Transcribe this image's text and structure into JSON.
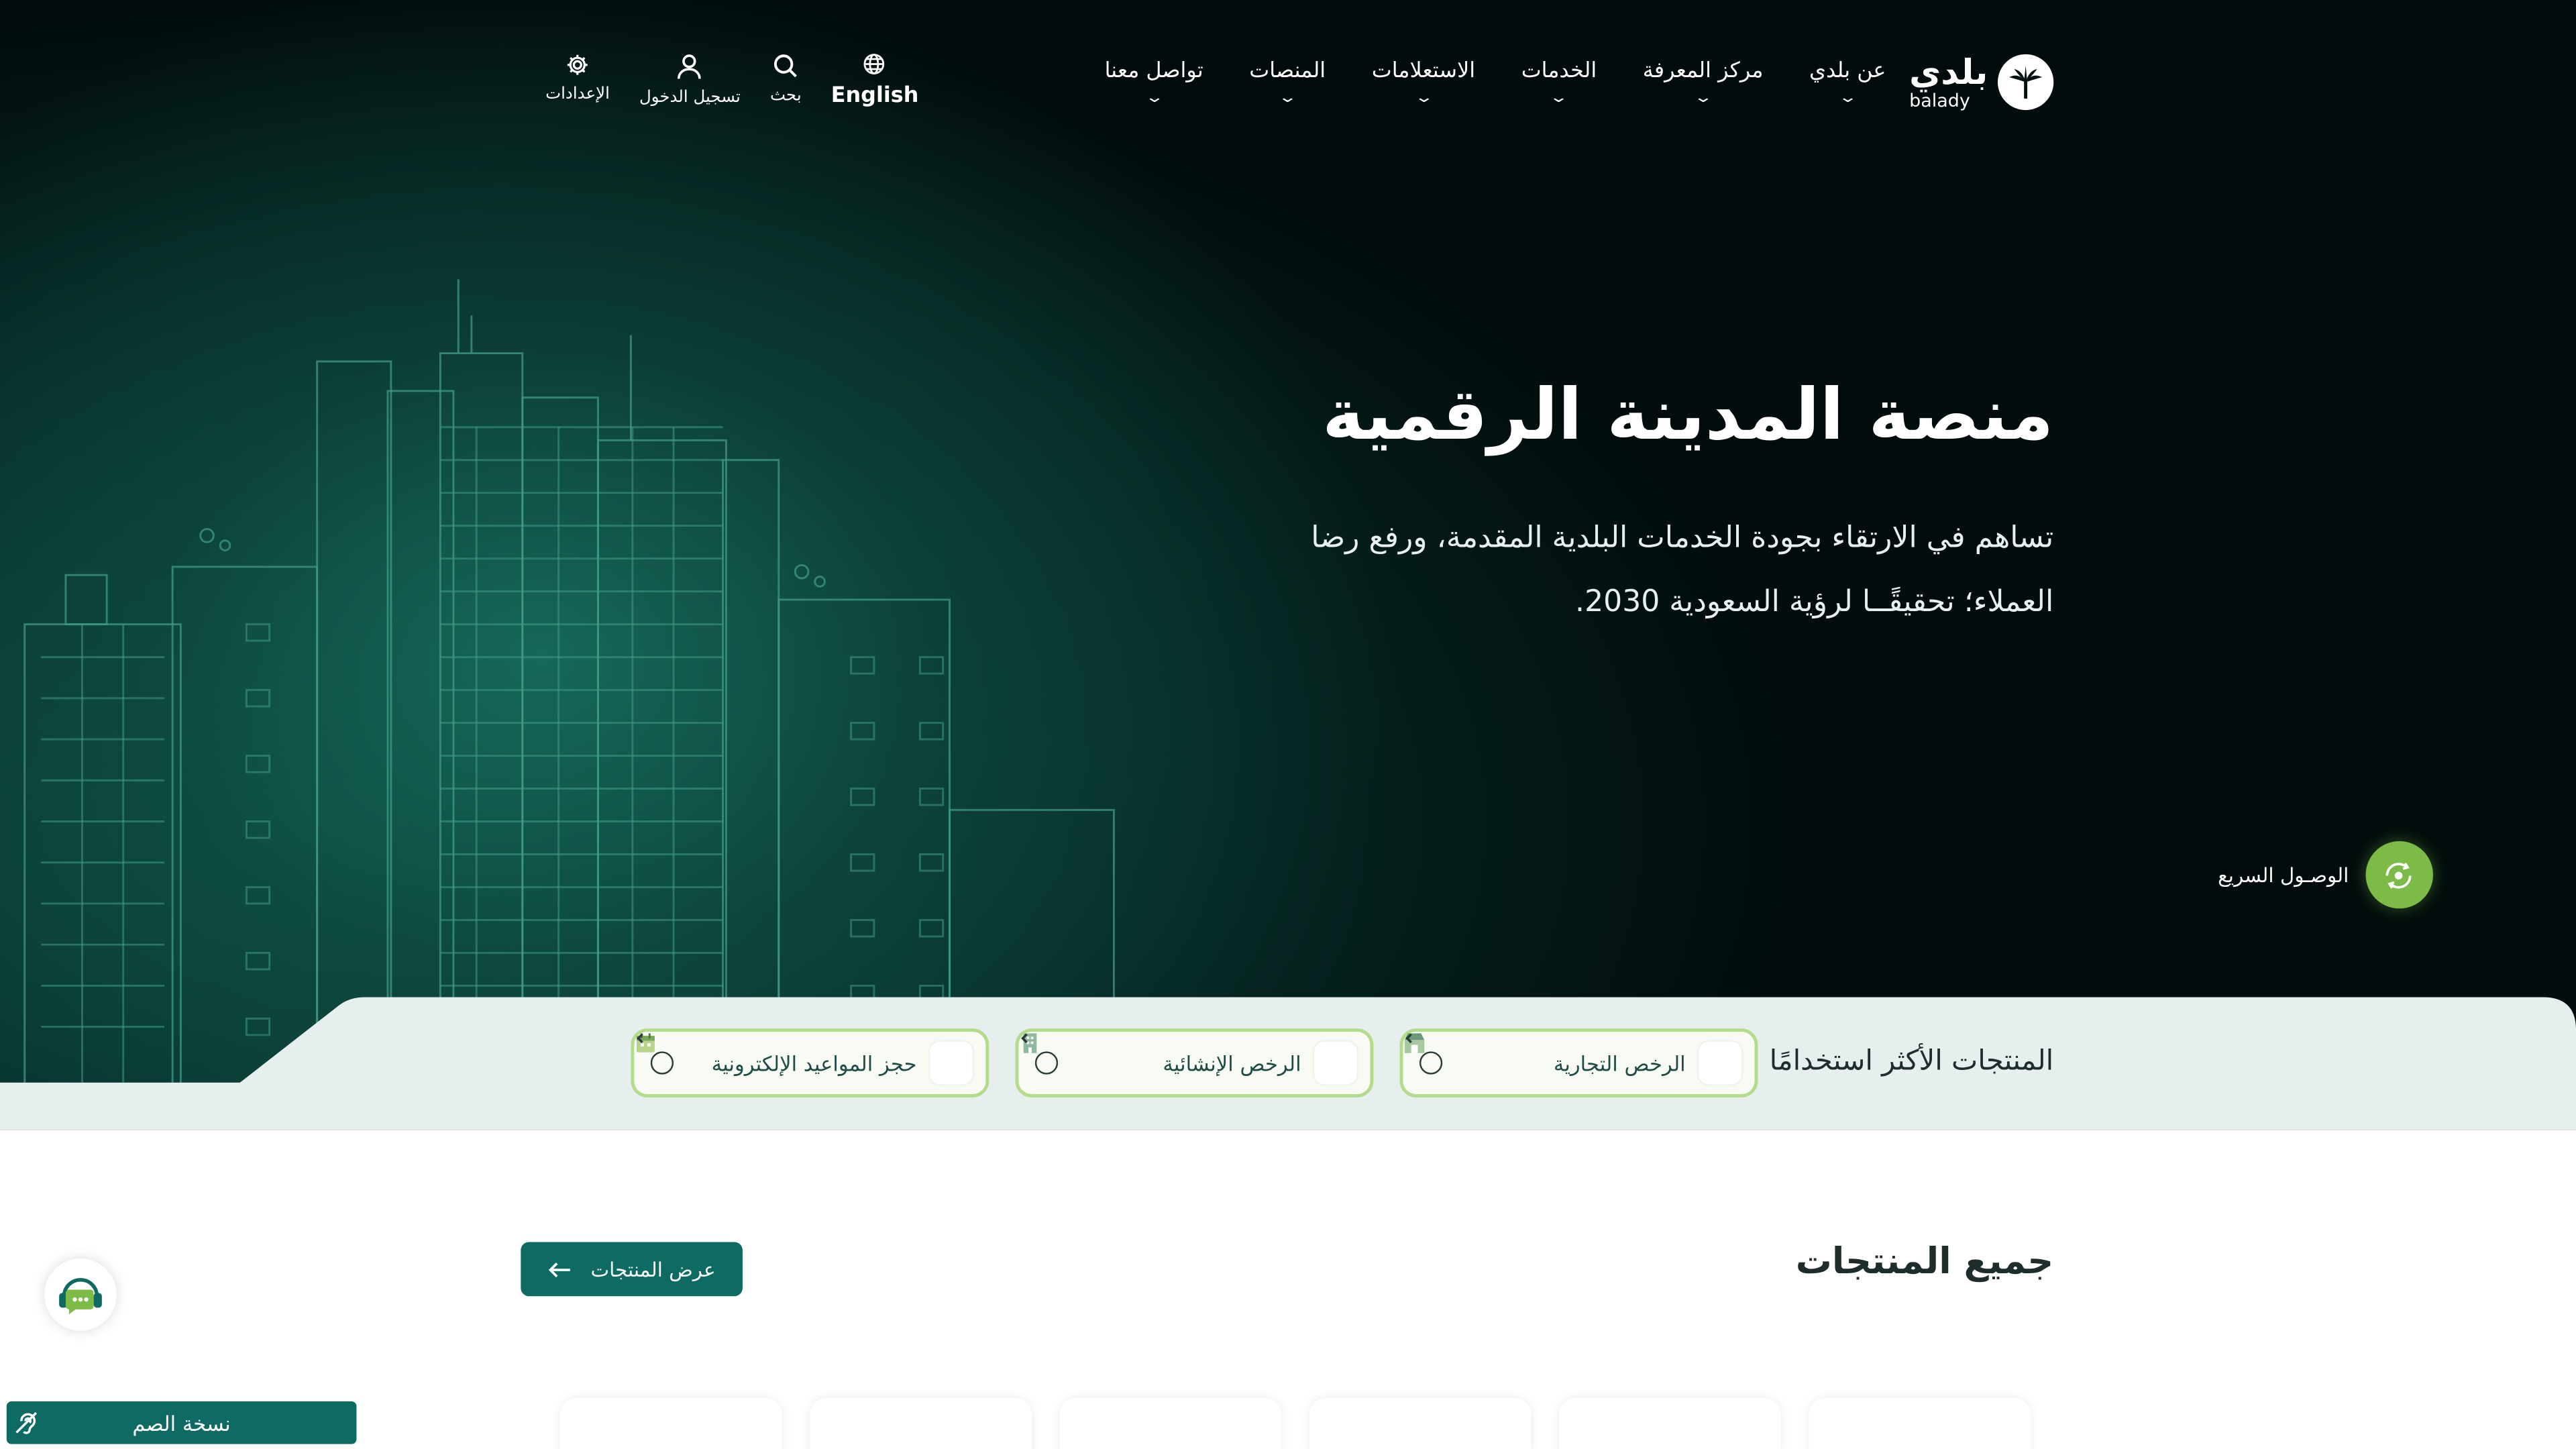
{
  "nav": {
    "logo_ar": "بلدي",
    "logo_en": "balady",
    "menu": [
      {
        "label": "عن بلدي"
      },
      {
        "label": "مركز المعرفة"
      },
      {
        "label": "الخدمات"
      },
      {
        "label": "الاستعلامات"
      },
      {
        "label": "المنصات"
      },
      {
        "label": "تواصل معنا"
      }
    ],
    "tools": {
      "language": "English",
      "search": "بحث",
      "login": "تسجيل الدخول",
      "settings": "الإعدادات"
    }
  },
  "hero": {
    "title": "منصة المدينة الرقمية",
    "description": "تساهم في الارتقاء بجودة الخدمات البلدية المقدمة، ورفع رضا العملاء؛ تحقيقًــا لرؤية السعودية 2030."
  },
  "quick_access": {
    "label": "الوصـول السريع"
  },
  "most_used": {
    "title": "المنتجات الأكثر استخدامًا",
    "items": [
      {
        "label": "الرخص التجارية",
        "icon": "store-icon"
      },
      {
        "label": "الرخص الإنشائية",
        "icon": "building-icon"
      },
      {
        "label": "حجز المواعيد الإلكترونية",
        "icon": "calendar-icon"
      }
    ]
  },
  "all_products": {
    "title": "جميع المنتجات",
    "button": "عرض المنتجات"
  },
  "deaf_version": {
    "label": "نسخة الصم"
  },
  "colors": {
    "brand_green": "#0e6b63",
    "accent_lime": "#7cbb45",
    "pill_border": "#b3dc8a",
    "band_bg": "#e6efee"
  }
}
